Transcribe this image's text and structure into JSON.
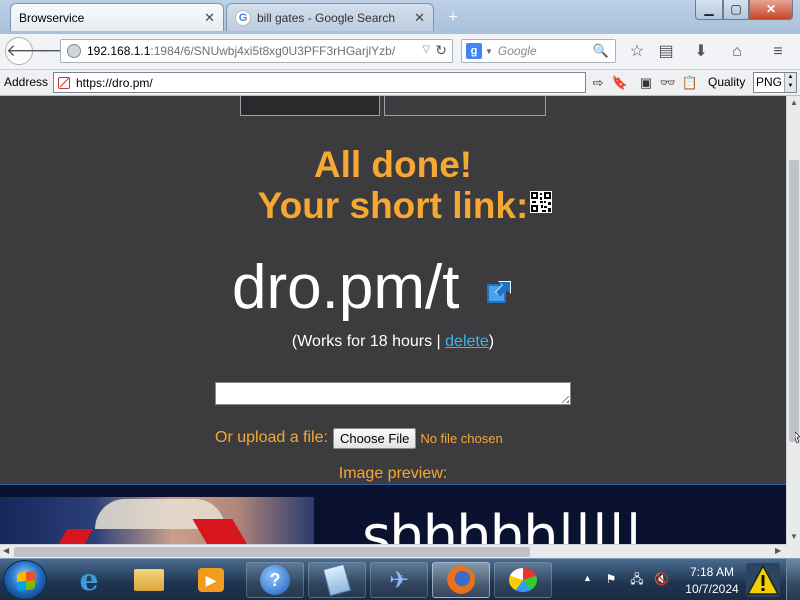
{
  "browser": {
    "tabs": [
      {
        "label": "Browservice",
        "active": true
      },
      {
        "label": "bill gates - Google Search",
        "active": false
      }
    ],
    "close_glyph": "✕",
    "new_tab_glyph": "+",
    "window_controls": {
      "minimize": "▁",
      "maximize": "▢",
      "close": "✕"
    },
    "url": {
      "host": "192.168.1.1",
      "path": ":1984/6/SNUwbj4xi5t8xg0U3PFF3rHGarjlYzb/"
    },
    "search": {
      "engine": "Google",
      "placeholder": "Google"
    }
  },
  "addon_toolbar": {
    "address_label": "Address",
    "address_value": "https://dro.pm/",
    "quality_label": "Quality",
    "quality_value": "PNG"
  },
  "page": {
    "heading_line1": "All done!",
    "heading_line2": "Your short link:",
    "short_link": "dro.pm/t",
    "works_prefix": "(Works for 18 hours | ",
    "delete_label": "delete",
    "works_suffix": ")",
    "textarea_value": "",
    "upload_label": "Or upload a file:",
    "choose_file_label": "Choose File",
    "no_file_label": "No file chosen",
    "preview_label": "Image preview:",
    "preview_text": "shhhhh|||||",
    "accent_color": "#f7a832",
    "link_color": "#39b6ee"
  },
  "taskbar": {
    "apps": [
      {
        "name": "internet-explorer",
        "active": false
      },
      {
        "name": "windows-explorer",
        "active": false
      },
      {
        "name": "media-player",
        "active": false
      },
      {
        "name": "help-and-support",
        "active": false
      },
      {
        "name": "notepad",
        "active": false
      },
      {
        "name": "airplane-app",
        "active": false
      },
      {
        "name": "firefox",
        "active": true
      },
      {
        "name": "paint",
        "active": false
      }
    ],
    "clock_time": "7:18 AM",
    "clock_date": "10/7/2024"
  }
}
